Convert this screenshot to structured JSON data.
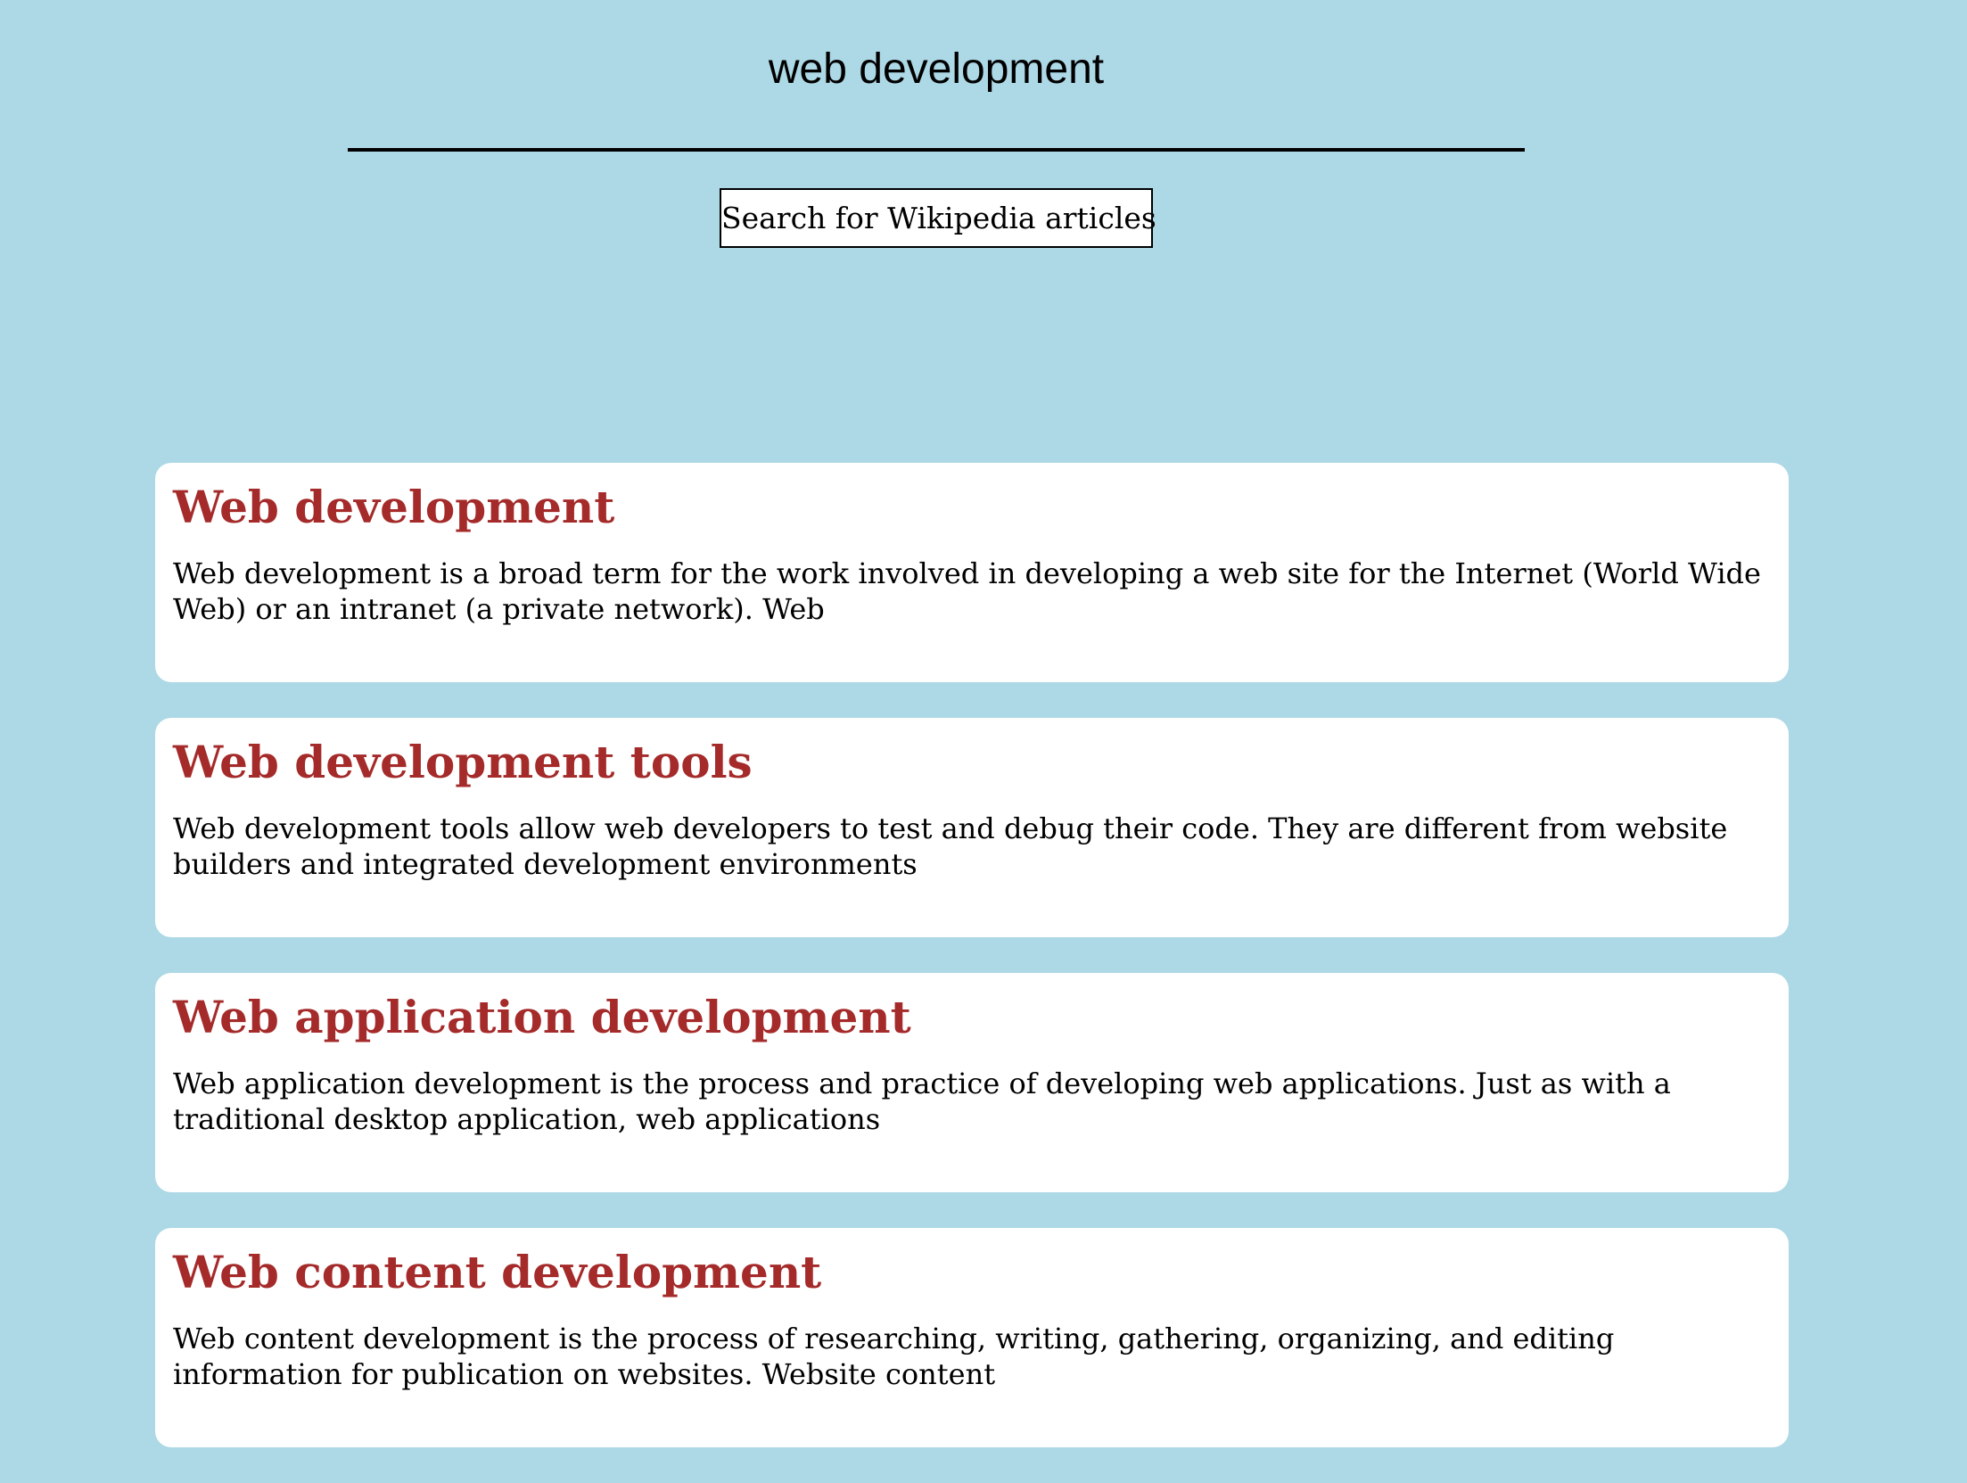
{
  "search": {
    "value": "web development",
    "button_label": "Search for Wikipedia articles"
  },
  "results": [
    {
      "title": "Web development",
      "snippet": "Web development is a broad term for the work involved in developing a web site for the Internet (World Wide Web) or an intranet (a private network). Web"
    },
    {
      "title": "Web development tools",
      "snippet": "Web development tools allow web developers to test and debug their code. They are different from website builders and integrated development environments"
    },
    {
      "title": "Web application development",
      "snippet": "Web application development is the process and practice of developing web applications. Just as with a traditional desktop application, web applications"
    },
    {
      "title": "Web content development",
      "snippet": "Web content development is the process of researching, writing, gathering, organizing, and editing information for publication on websites. Website content"
    }
  ],
  "colors": {
    "page_background": "#add8e6",
    "card_background": "#ffffff",
    "title_text": "#a52a2a",
    "body_text": "#000000"
  }
}
